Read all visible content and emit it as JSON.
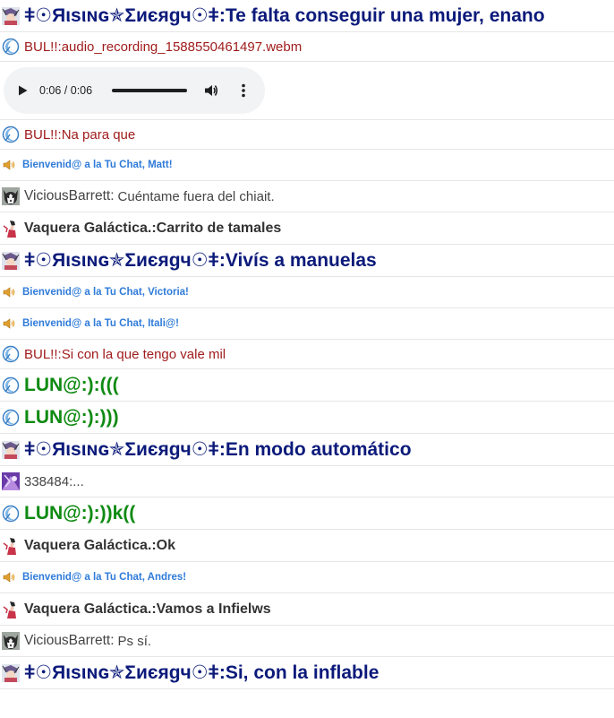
{
  "messages": [
    {
      "style": "big",
      "avatar": "anime-avatar",
      "name": "ǂ☉Яιѕιɴɢ✯Σиєяgч☉ǂ",
      "sep": ":",
      "text": " Te falta conseguir una mujer, enano"
    },
    {
      "style": "red",
      "avatar": "moon-avatar",
      "name": "BUL!!",
      "sep": ":",
      "text": " audio_recording_1588550461497.webm"
    },
    {
      "style": "audio",
      "time": "0:06 / 0:06",
      "progress": 1.0
    },
    {
      "style": "red",
      "avatar": "moon-avatar",
      "name": "BUL!!",
      "sep": ":",
      "text": " Na para que"
    },
    {
      "style": "sys",
      "avatar": "speaker-avatar",
      "text": "Bienvenid@ a la Tu Chat, Matt!"
    },
    {
      "style": "gray",
      "avatar": "husky-avatar",
      "name": "ViciousBarrett",
      "sep": ":",
      "text": "Cuéntame fuera del chiait."
    },
    {
      "style": "bold",
      "avatar": "cowgirl-avatar",
      "name": "Vaquera Galáctica.",
      "sep": ":",
      "text": " Carrito de tamales"
    },
    {
      "style": "big",
      "avatar": "anime-avatar",
      "name": "ǂ☉Яιѕιɴɢ✯Σиєяgч☉ǂ",
      "sep": ":",
      "text": " Vivís a manuelas"
    },
    {
      "style": "sys",
      "avatar": "speaker-avatar",
      "text": "Bienvenid@ a la Tu Chat, Victoria!"
    },
    {
      "style": "sys",
      "avatar": "speaker-avatar",
      "text": "Bienvenid@ a la Tu Chat, Itali@!"
    },
    {
      "style": "red",
      "avatar": "moon-avatar",
      "name": "BUL!!",
      "sep": ":",
      "text": " Si con la que tengo vale mil"
    },
    {
      "style": "green",
      "avatar": "moon-avatar",
      "name": "LUN@:)",
      "sep": ":",
      "text": " ((("
    },
    {
      "style": "green",
      "avatar": "moon-avatar",
      "name": "LUN@:)",
      "sep": ":",
      "text": " )))"
    },
    {
      "style": "big",
      "avatar": "anime-avatar",
      "name": "ǂ☉Яιѕιɴɢ✯Σиєяgч☉ǂ",
      "sep": ":",
      "text": " En modo automático"
    },
    {
      "style": "plain",
      "avatar": "purple-avatar",
      "name": "338484",
      "sep": ":",
      "text": " ..."
    },
    {
      "style": "green",
      "avatar": "moon-avatar",
      "name": "LUN@:)",
      "sep": ":",
      "text": " ))k(("
    },
    {
      "style": "bold",
      "avatar": "cowgirl-avatar",
      "name": "Vaquera Galáctica.",
      "sep": ":",
      "text": " Ok"
    },
    {
      "style": "sys",
      "avatar": "speaker-avatar",
      "text": "Bienvenid@ a la Tu Chat, Andres!"
    },
    {
      "style": "bold",
      "avatar": "cowgirl-avatar",
      "name": "Vaquera Galáctica.",
      "sep": ":",
      "text": " Vamos a Infielws"
    },
    {
      "style": "gray",
      "avatar": "husky-avatar",
      "name": "ViciousBarrett",
      "sep": ":",
      "text": "Ps sí."
    },
    {
      "style": "big",
      "avatar": "anime-avatar",
      "name": "ǂ☉Яιѕιɴɢ✯Σиєяgч☉ǂ",
      "sep": ":",
      "text": " Si, con la inflable"
    }
  ]
}
